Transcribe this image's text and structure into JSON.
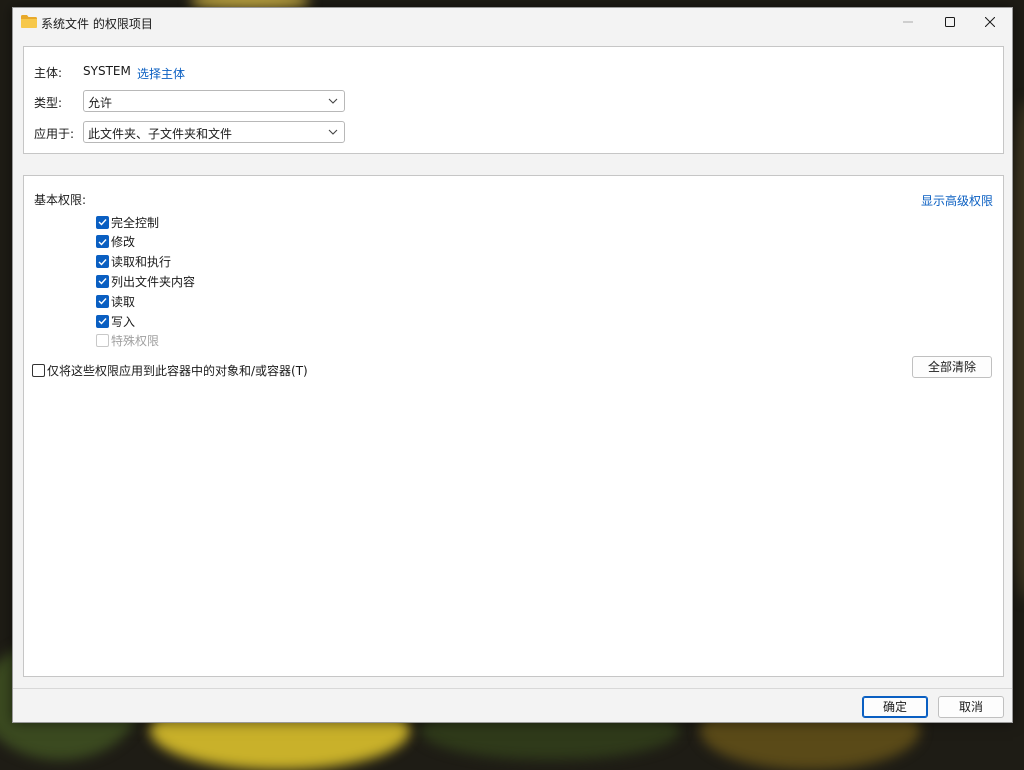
{
  "window": {
    "title": "系统文件 的权限项目",
    "icon": "folder-icon",
    "folder_color": "#f5c242"
  },
  "principal": {
    "label": "主体:",
    "value": "SYSTEM",
    "select_link": "选择主体"
  },
  "type": {
    "label": "类型:",
    "value": "允许"
  },
  "applies_to": {
    "label": "应用于:",
    "value": "此文件夹、子文件夹和文件"
  },
  "permissions": {
    "label": "基本权限:",
    "advanced_link": "显示高级权限",
    "items": [
      {
        "label": "完全控制",
        "checked": true,
        "enabled": true
      },
      {
        "label": "修改",
        "checked": true,
        "enabled": true
      },
      {
        "label": "读取和执行",
        "checked": true,
        "enabled": true
      },
      {
        "label": "列出文件夹内容",
        "checked": true,
        "enabled": true
      },
      {
        "label": "读取",
        "checked": true,
        "enabled": true
      },
      {
        "label": "写入",
        "checked": true,
        "enabled": true
      },
      {
        "label": "特殊权限",
        "checked": false,
        "enabled": false
      }
    ],
    "apply_only_label": "仅将这些权限应用到此容器中的对象和/或容器(T)",
    "apply_only_checked": false,
    "clear_all_button": "全部清除"
  },
  "footer": {
    "ok_button": "确定",
    "cancel_button": "取消"
  },
  "colors": {
    "accent": "#0a5fc2",
    "window_bg": "#f3f3f3",
    "panel_bg": "#ffffff"
  }
}
